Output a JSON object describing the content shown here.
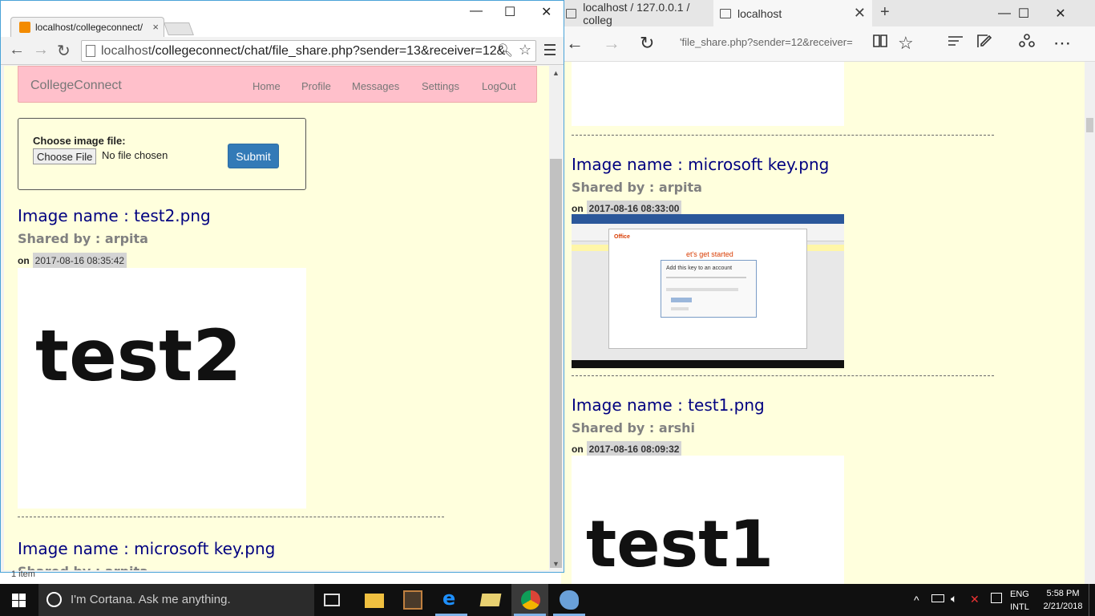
{
  "edge": {
    "tab1_title": "localhost / 127.0.0.1 / colleg",
    "tab2_title": "localhost",
    "tab2_close": "✕",
    "new_tab": "+",
    "minimize": "—",
    "maximize": "☐",
    "close": "✕",
    "url": "'file_share.php?sender=12&receiver=",
    "posts": [
      {
        "name": "Image name : microsoft key.png",
        "shared": "Shared by : arpita",
        "on": "on",
        "date": "2017-08-16 08:33:00"
      },
      {
        "name": "Image name : test1.png",
        "shared": "Shared by : arshi",
        "on": "on",
        "date": "2017-08-16 08:09:32"
      }
    ],
    "screenshot": {
      "office": "Office",
      "heading": "et's get started",
      "dialog_title": "Add this key to an account"
    },
    "test1_image_text": "test1"
  },
  "chrome": {
    "tab_title": "localhost/collegeconnect/",
    "tab_close": "×",
    "minimize": "—",
    "maximize": "☐",
    "close": "✕",
    "url_host": "localhost",
    "url_path": "/collegeconnect/chat/file_share.php?sender=13&receiver=12&",
    "site": {
      "brand": "CollegeConnect",
      "nav": [
        "Home",
        "Profile",
        "Messages",
        "Settings",
        "LogOut"
      ]
    },
    "upload": {
      "label": "Choose image file:",
      "choose_button": "Choose File",
      "no_file": "No file chosen",
      "submit": "Submit"
    },
    "posts": [
      {
        "name": "Image name : test2.png",
        "shared": "Shared by : arpita",
        "on": "on",
        "date": "2017-08-16 08:35:42"
      },
      {
        "name": "Image name : microsoft key.png",
        "shared": "Shared by : arpita"
      }
    ],
    "test2_image_text": "test2"
  },
  "status_text": "1 item",
  "taskbar": {
    "search_placeholder": "I'm Cortana. Ask me anything.",
    "language": "ENG",
    "layout": "INTL",
    "time": "5:58 PM",
    "date": "2/21/2018"
  },
  "colors": {
    "page_bg": "#ffffdd",
    "navbar_bg": "#ffc0cb",
    "image_name": "#000080",
    "submit_bg": "#337ab7"
  }
}
